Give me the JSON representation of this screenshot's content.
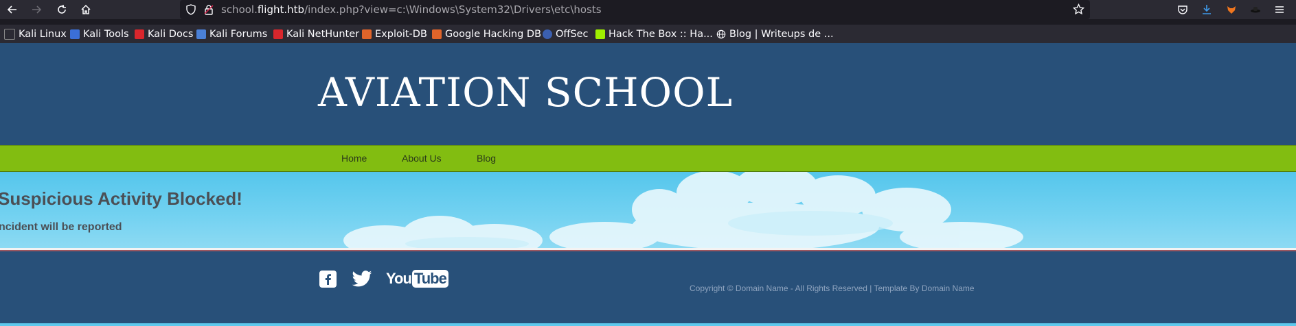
{
  "browser": {
    "url_prefix": "school.",
    "url_host": "flight.htb",
    "url_path": "/index.php?view=c:\\Windows\\System32\\Drivers\\etc\\hosts",
    "bookmarks": [
      {
        "label": "Kali Linux",
        "icon": "kali-dragon-icon"
      },
      {
        "label": "Kali Tools",
        "icon": "kali-tools-icon"
      },
      {
        "label": "Kali Docs",
        "icon": "kali-docs-icon"
      },
      {
        "label": "Kali Forums",
        "icon": "kali-forums-icon"
      },
      {
        "label": "Kali NetHunter",
        "icon": "kali-nethunter-icon"
      },
      {
        "label": "Exploit-DB",
        "icon": "exploit-db-icon"
      },
      {
        "label": "Google Hacking DB",
        "icon": "ghdb-icon"
      },
      {
        "label": "OffSec",
        "icon": "offsec-icon"
      },
      {
        "label": "Hack The Box :: Ha...",
        "icon": "htb-cube-icon"
      },
      {
        "label": "Blog | Writeups de ...",
        "icon": "globe-icon"
      }
    ]
  },
  "site": {
    "title": "AVIATION SCHOOL",
    "menu": [
      "Home",
      "About Us",
      "Blog"
    ],
    "hero_title": "Suspicious Activity Blocked!",
    "hero_subtitle": "ncident will be reported",
    "footer": {
      "social": [
        "facebook-icon",
        "twitter-icon",
        "youtube-icon"
      ],
      "youtube_you": "You",
      "youtube_tube": "Tube",
      "copyright": "Copyright © Domain Name - All Rights Reserved | Template By Domain Name"
    }
  },
  "colors": {
    "header_bg": "#285079",
    "menu_bg": "#82bd11",
    "hero_bg": "#55c6ec",
    "browser_bg": "#2b2a33"
  }
}
